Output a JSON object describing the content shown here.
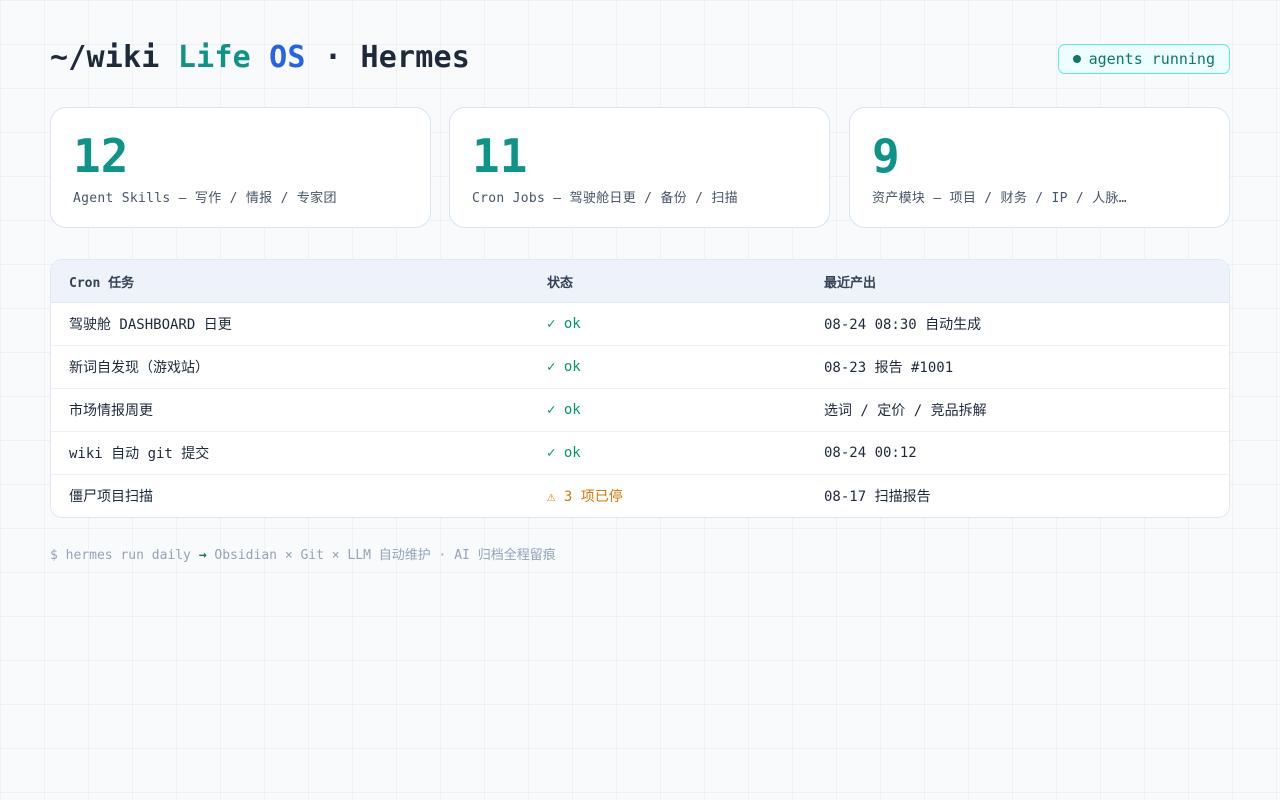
{
  "header": {
    "title_prefix": "~/wiki ",
    "title_life": "Life",
    "title_space": " ",
    "title_os": "OS",
    "title_suffix": " · Hermes",
    "status_label": "agents running"
  },
  "stats": [
    {
      "value": "12",
      "label": "Agent Skills — 写作 / 情报 / 专家团"
    },
    {
      "value": "11",
      "label": "Cron Jobs — 驾驶舱日更 / 备份 / 扫描"
    },
    {
      "value": "9",
      "label": "资产模块 — 项目 / 财务 / IP / 人脉…"
    }
  ],
  "table": {
    "headers": [
      "Cron 任务",
      "状态",
      "最近产出"
    ],
    "rows": [
      {
        "task": "驾驶舱 DASHBOARD 日更",
        "status": "✓ ok",
        "status_type": "ok",
        "output": "08-24 08:30 自动生成"
      },
      {
        "task": "新词自发现（游戏站）",
        "status": "✓ ok",
        "status_type": "ok",
        "output": "08-23 报告 #1001"
      },
      {
        "task": "市场情报周更",
        "status": "✓ ok",
        "status_type": "ok",
        "output": "选词 / 定价 / 竞品拆解"
      },
      {
        "task": "wiki 自动 git 提交",
        "status": "✓ ok",
        "status_type": "ok",
        "output": "08-24 00:12"
      },
      {
        "task": "僵尸项目扫描",
        "status": "⚠ 3 项已停",
        "status_type": "warn",
        "output": "08-17 扫描报告"
      }
    ]
  },
  "footer": {
    "prefix": "$ hermes run daily ",
    "arrow": "→",
    "suffix": " Obsidian × Git × LLM 自动维护 · AI 归档全程留痕"
  },
  "colors": {
    "accent_teal": "#0d9488",
    "accent_blue": "#2563eb",
    "ok_green": "#059669",
    "warn_orange": "#d97706"
  },
  "icons": {
    "status_dot": "status-dot-icon",
    "ok": "check-icon",
    "warn": "warning-icon"
  }
}
